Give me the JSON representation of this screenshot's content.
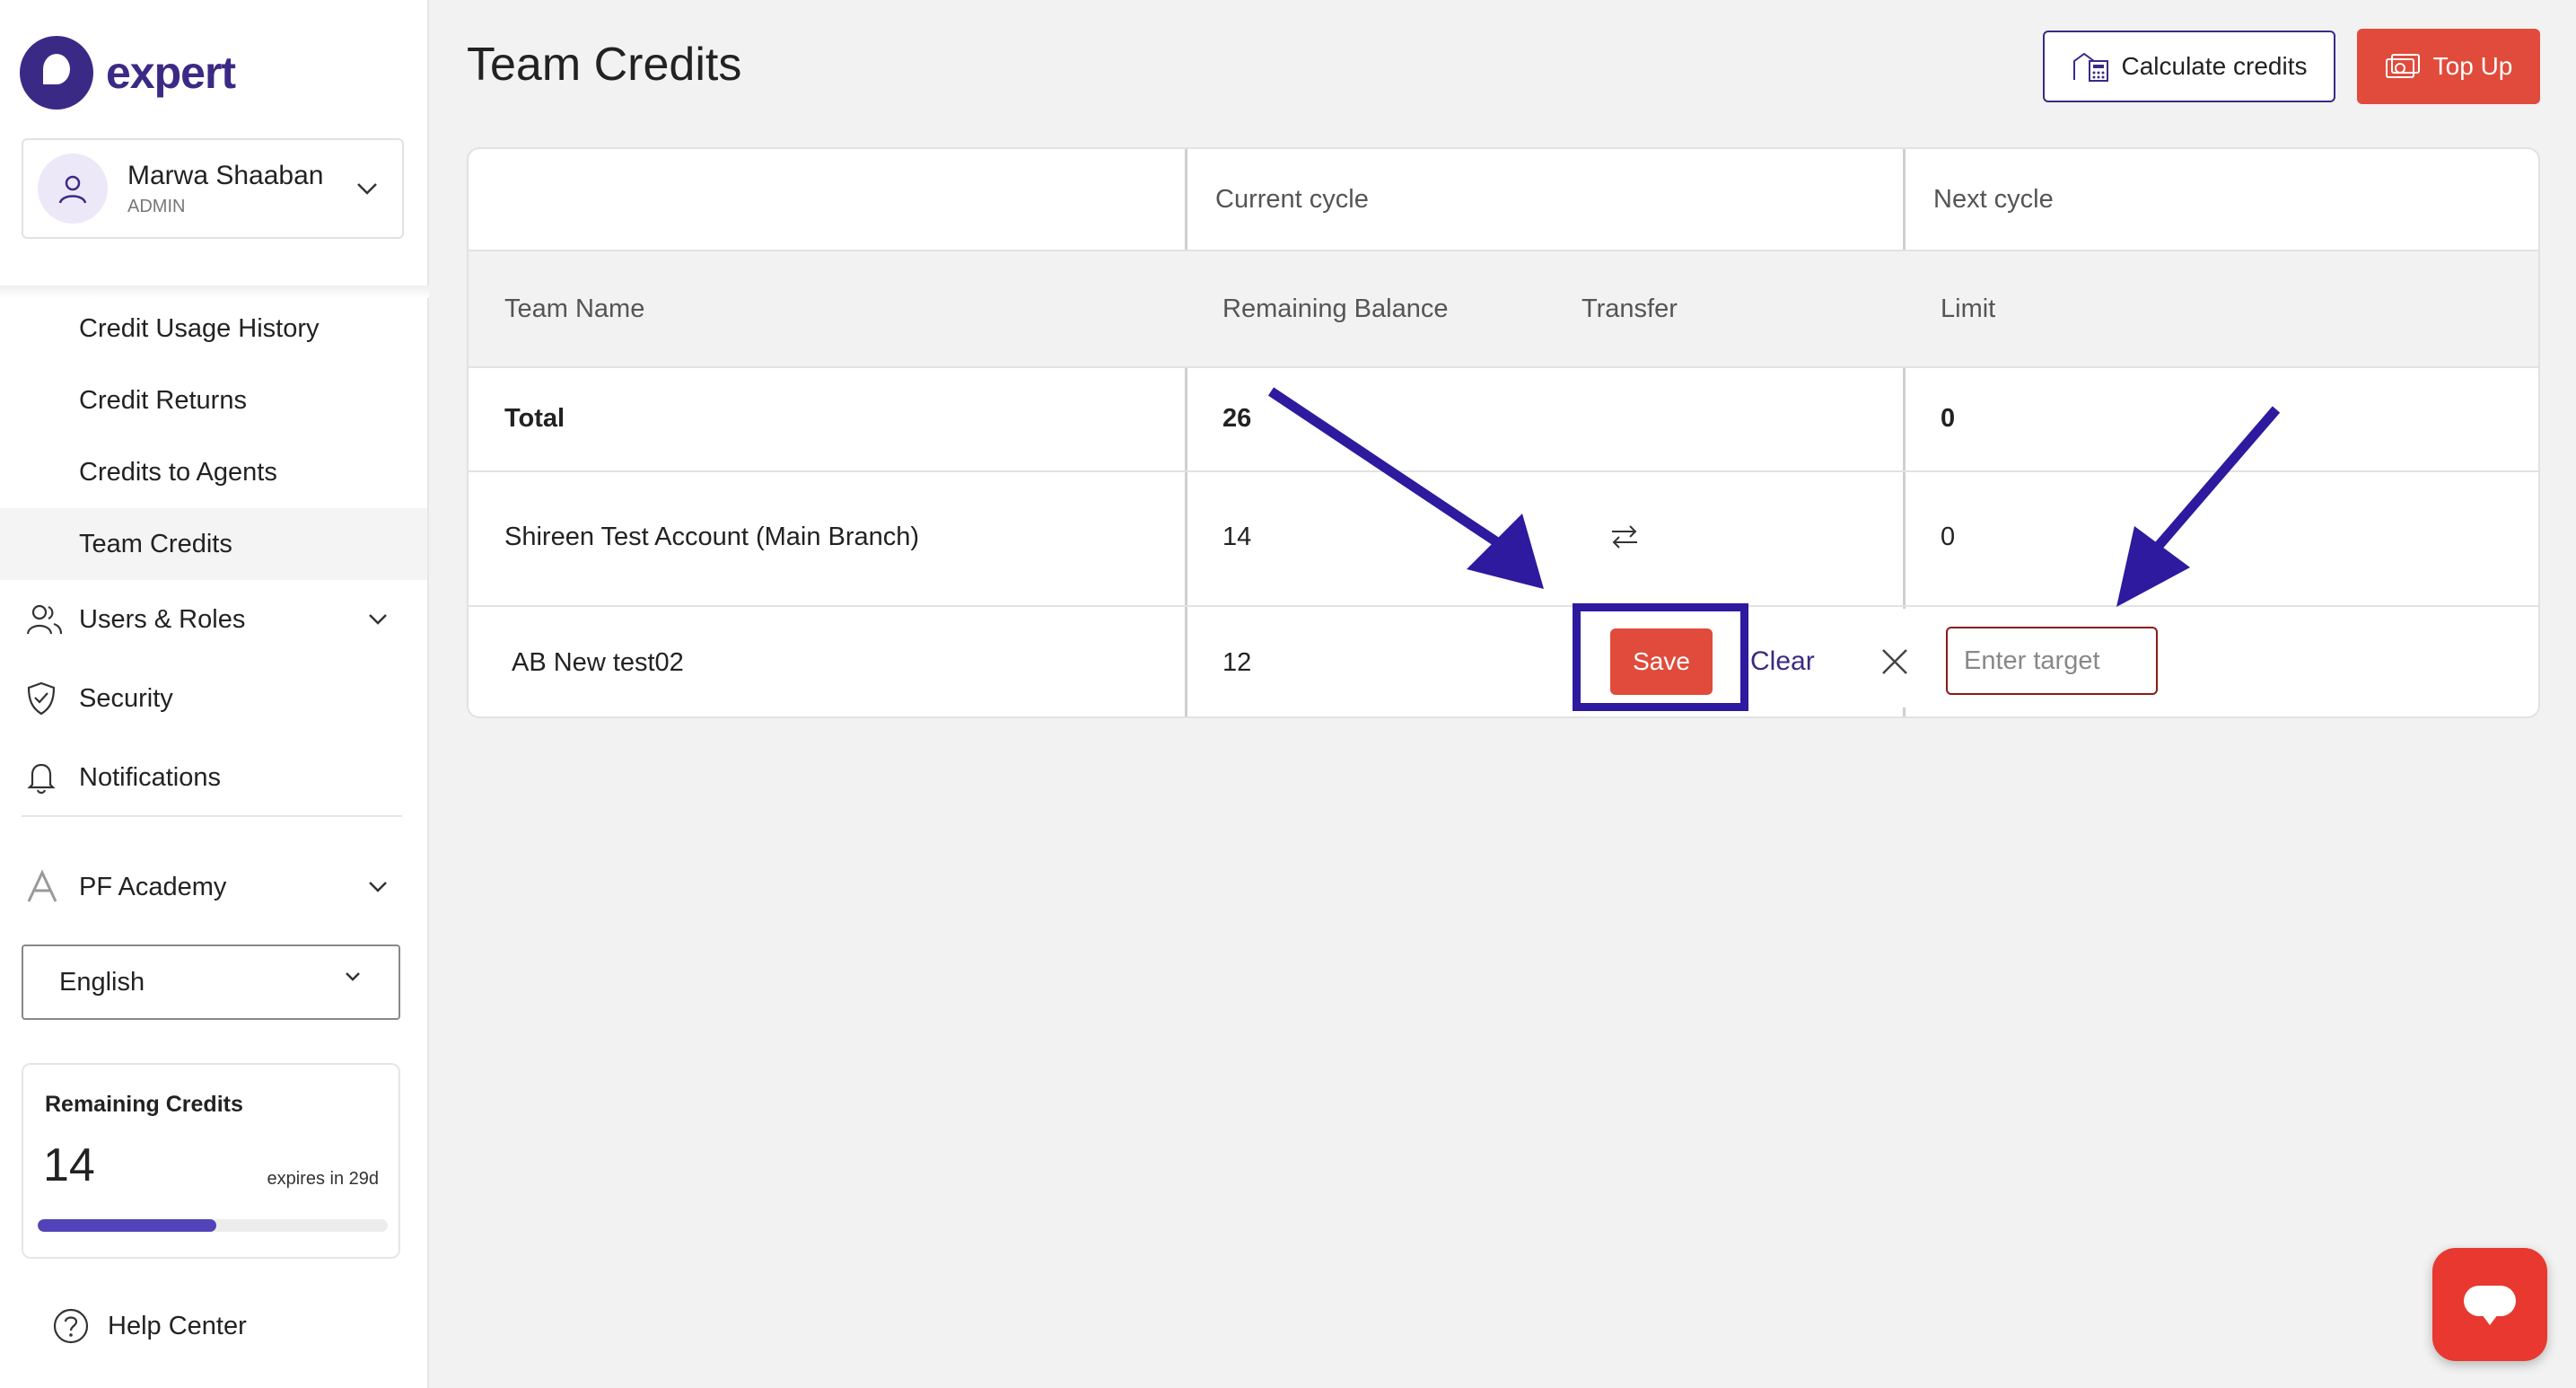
{
  "brand": {
    "name": "expert",
    "color": "#3b2a85"
  },
  "user": {
    "name": "Marwa Shaaban",
    "role": "ADMIN"
  },
  "sidebar": {
    "sub_items": [
      {
        "label": "Credit Usage History"
      },
      {
        "label": "Credit Returns"
      },
      {
        "label": "Credits to Agents"
      },
      {
        "label": "Team Credits",
        "active": true
      }
    ],
    "nav": [
      {
        "label": "Users & Roles",
        "icon": "users-icon"
      },
      {
        "label": "Security",
        "icon": "shield-icon"
      },
      {
        "label": "Notifications",
        "icon": "bell-icon"
      },
      {
        "label": "PF Academy",
        "icon": "academy-icon"
      }
    ],
    "language": "English",
    "credits": {
      "title": "Remaining Credits",
      "value": "14",
      "expires": "expires in 29d",
      "progress": 0.51
    },
    "help": "Help Center"
  },
  "page": {
    "title": "Team Credits",
    "calculate_label": "Calculate credits",
    "topup_label": "Top Up"
  },
  "table": {
    "group_headers": {
      "current": "Current cycle",
      "next": "Next cycle"
    },
    "columns": {
      "team": "Team Name",
      "remaining": "Remaining Balance",
      "transfer": "Transfer",
      "limit": "Limit"
    },
    "total": {
      "label": "Total",
      "remaining": "26",
      "limit": "0"
    },
    "rows": [
      {
        "team": "Shireen Test Account (Main Branch)",
        "remaining": "14",
        "limit": "0"
      },
      {
        "team": "AB New test02",
        "remaining": "12"
      }
    ],
    "edit": {
      "save": "Save",
      "clear": "Clear",
      "placeholder": "Enter target"
    }
  },
  "colors": {
    "accent": "#e04b3c",
    "annotation": "#2d1a9e",
    "progress": "#5343b8"
  }
}
